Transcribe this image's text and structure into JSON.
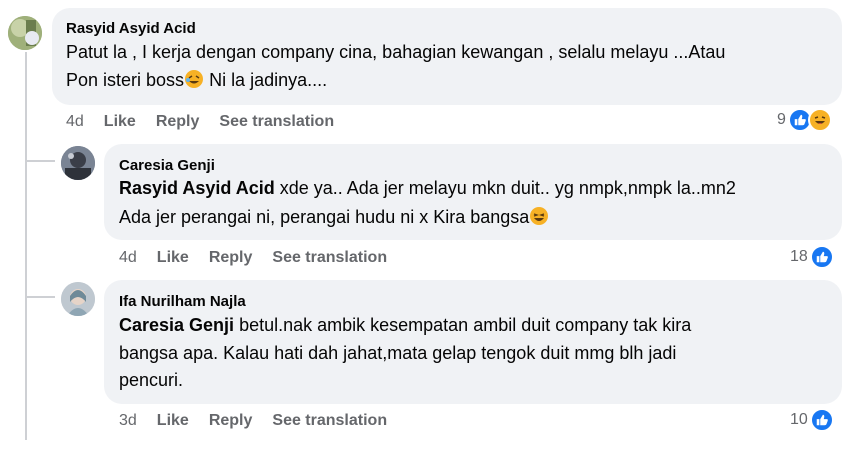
{
  "comments": [
    {
      "author": "Rasyid Asyid Acid",
      "line1": "Patut la , I kerja dengan company cina, bahagian kewangan , selalu melayu ...Atau",
      "line2a": "Pon isteri boss",
      "line2b": " Ni la jadinya....",
      "time": "4d",
      "like": "Like",
      "reply": "Reply",
      "translate": "See translation",
      "reaction_count": "9",
      "reactions": [
        "like-icon",
        "haha-icon"
      ]
    },
    {
      "author": "Caresia Genji",
      "mention": "Rasyid Asyid Acid",
      "line1_rest": " xde ya.. Ada jer melayu mkn duit.. yg nmpk,nmpk la..mn2",
      "line2": "Ada jer perangai ni, perangai hudu ni x Kira bangsa",
      "time": "4d",
      "like": "Like",
      "reply": "Reply",
      "translate": "See translation",
      "reaction_count": "18",
      "reactions": [
        "like-icon"
      ]
    },
    {
      "author": "Ifa Nurilham Najla",
      "mention": "Caresia Genji",
      "line1_rest": " betul.nak ambik kesempatan ambil duit company tak kira",
      "line2": "bangsa apa. Kalau hati dah jahat,mata gelap tengok duit mmg blh jadi",
      "line3": "pencuri.",
      "time": "3d",
      "like": "Like",
      "reply": "Reply",
      "translate": "See translation",
      "reaction_count": "10",
      "reactions": [
        "like-icon"
      ]
    }
  ],
  "colors": {
    "bubble": "#f0f2f5",
    "meta": "#65676b",
    "like_blue": "#1877f2",
    "thread_line": "#ced0d4"
  }
}
